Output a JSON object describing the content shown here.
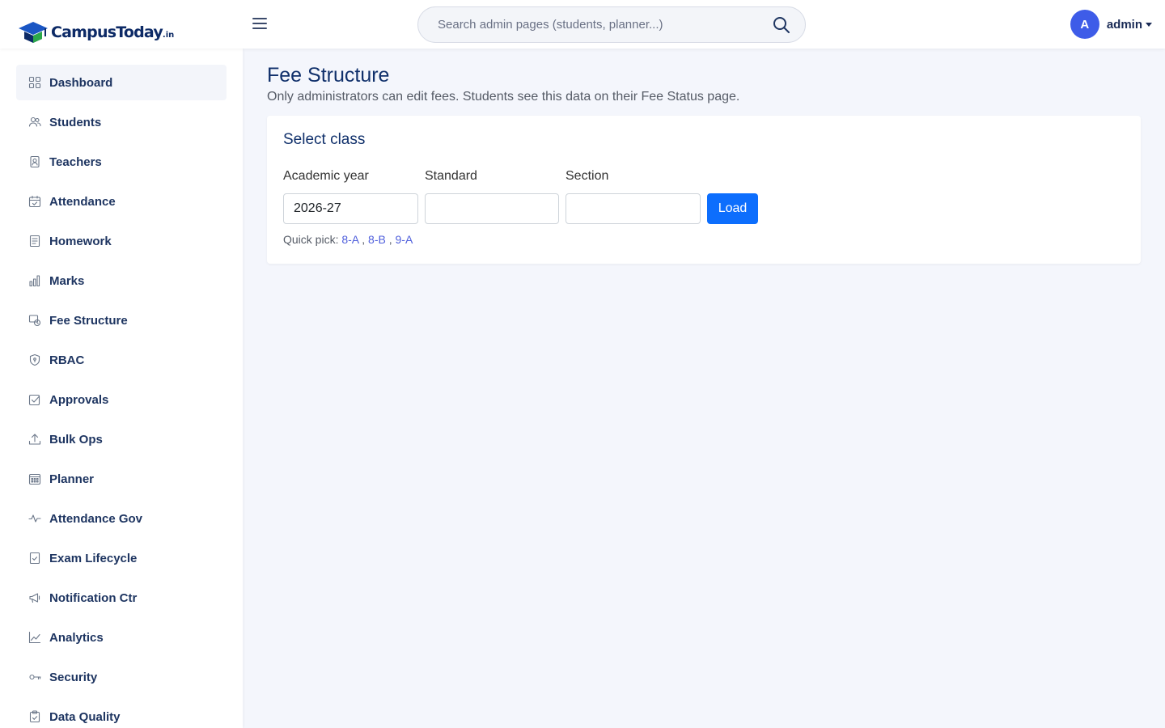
{
  "header": {
    "brand_campus": "Campus",
    "brand_today": "Today",
    "brand_tld": ".in",
    "search_placeholder": "Search admin pages (students, planner...)",
    "avatar_letter": "A",
    "user_name": "admin"
  },
  "sidebar": {
    "items": [
      {
        "label": "Dashboard",
        "icon": "grid-icon",
        "active": true
      },
      {
        "label": "Students",
        "icon": "users-icon"
      },
      {
        "label": "Teachers",
        "icon": "id-badge-icon"
      },
      {
        "label": "Attendance",
        "icon": "calendar-check-icon"
      },
      {
        "label": "Homework",
        "icon": "journal-icon"
      },
      {
        "label": "Marks",
        "icon": "bar-chart-icon"
      },
      {
        "label": "Fee Structure",
        "icon": "fee-clock-icon"
      },
      {
        "label": "RBAC",
        "icon": "shield-icon"
      },
      {
        "label": "Approvals",
        "icon": "check-square-icon"
      },
      {
        "label": "Bulk Ops",
        "icon": "upload-icon"
      },
      {
        "label": "Planner",
        "icon": "calendar-grid-icon"
      },
      {
        "label": "Attendance Gov",
        "icon": "activity-icon"
      },
      {
        "label": "Exam Lifecycle",
        "icon": "journal-check-icon"
      },
      {
        "label": "Notification Ctr",
        "icon": "megaphone-icon"
      },
      {
        "label": "Analytics",
        "icon": "graph-up-icon"
      },
      {
        "label": "Security",
        "icon": "key-icon"
      },
      {
        "label": "Data Quality",
        "icon": "clipboard-check-icon"
      }
    ]
  },
  "main": {
    "title": "Fee Structure",
    "subtitle": "Only administrators can edit fees. Students see this data on their Fee Status page.",
    "card": {
      "title": "Select class",
      "academic_year_label": "Academic year",
      "academic_year_value": "2026-27",
      "standard_label": "Standard",
      "standard_value": "",
      "section_label": "Section",
      "section_value": "",
      "load_label": "Load",
      "quick_pick_label": "Quick pick:",
      "quick_picks": [
        "8-A",
        "8-B",
        "9-A"
      ]
    }
  },
  "colors": {
    "accent": "#0d6efd",
    "brand_navy": "#0d2a66",
    "avatar": "#3e5ce8",
    "page_bg": "#f4f6fc"
  }
}
